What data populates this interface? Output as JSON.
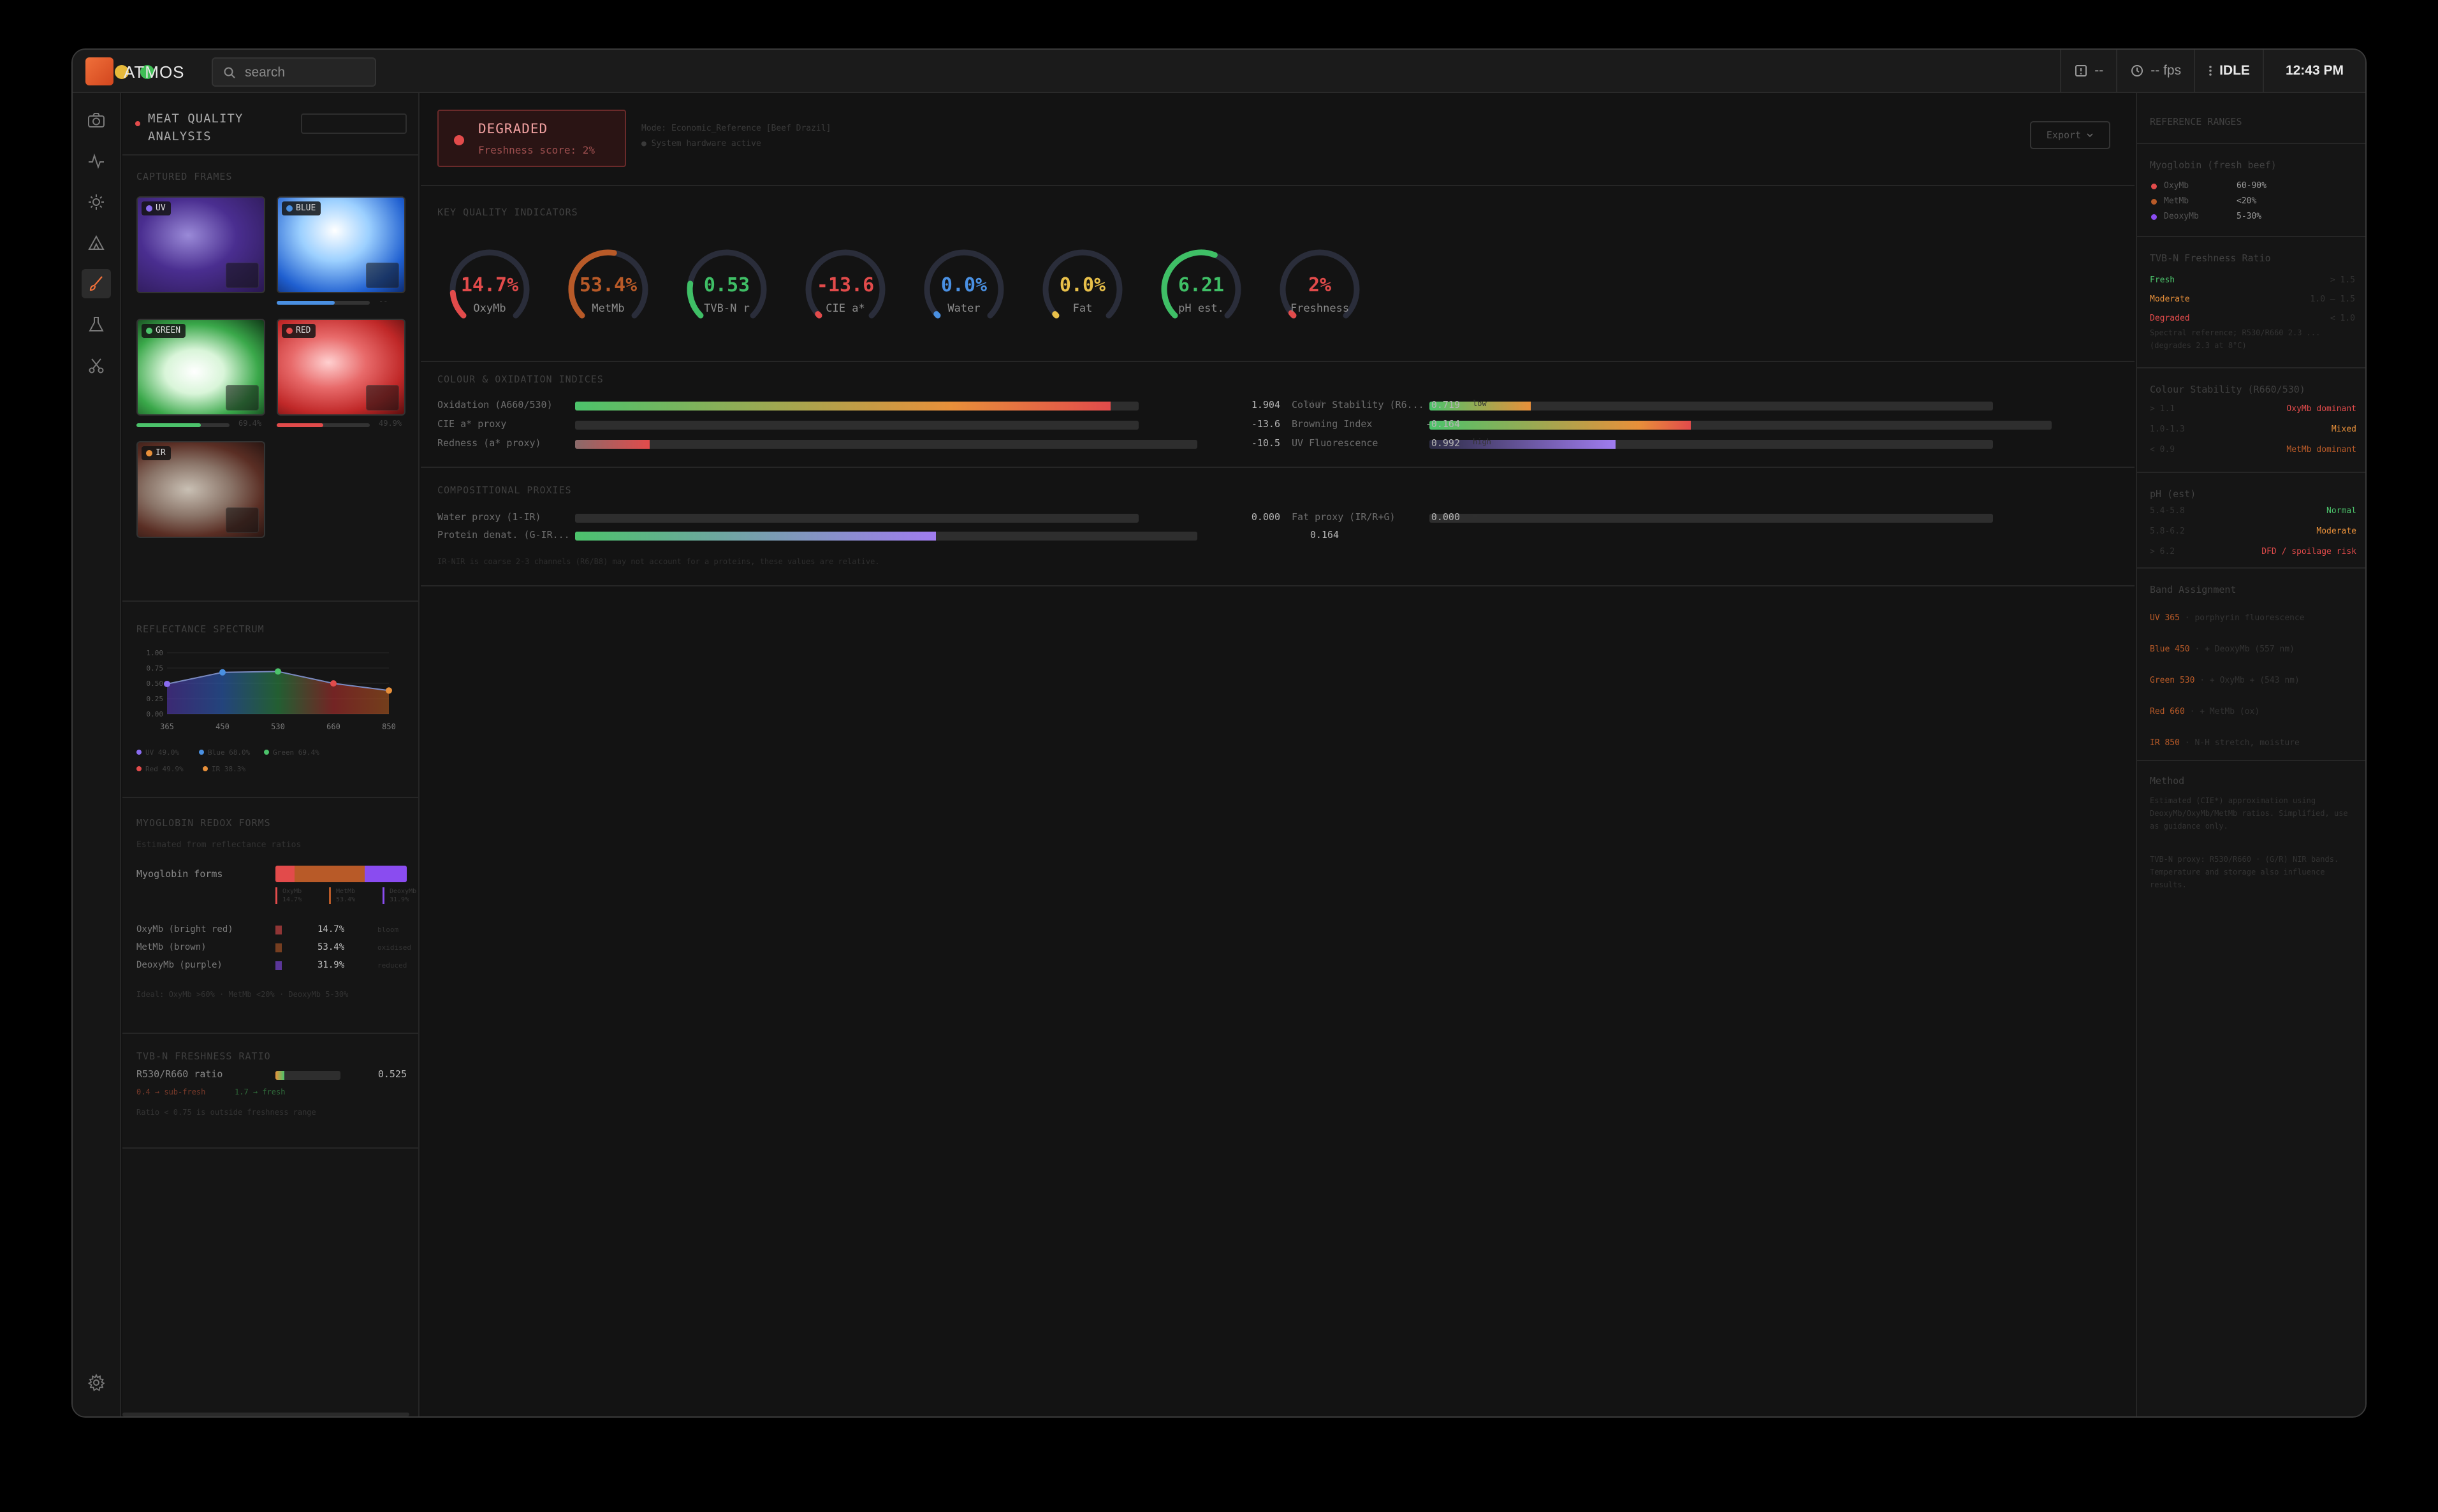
{
  "window": {
    "app_name": "ATMOS",
    "search_placeholder": "search",
    "status_alert": "--",
    "fps": "-- fps",
    "state": "IDLE",
    "clock": "12:43 PM"
  },
  "rail": {
    "icons": [
      "camera-icon",
      "activity-icon",
      "sun-icon",
      "tent-icon",
      "brush-icon",
      "flask-icon",
      "scissors-icon",
      "gear-icon"
    ],
    "active": "brush-icon"
  },
  "left": {
    "title_line1": "MEAT QUALITY",
    "title_line2": "ANALYSIS",
    "frames_title": "CAPTURED FRAMES",
    "frames": [
      {
        "tag": "UV",
        "dot": "#8a6cf0",
        "bar": 0,
        "value": ""
      },
      {
        "tag": "BLUE",
        "dot": "#4a90e2",
        "bar": 0.62,
        "value": "--"
      },
      {
        "tag": "GREEN",
        "dot": "#4cc36b",
        "bar": 0.69,
        "value": "69.4%"
      },
      {
        "tag": "RED",
        "dot": "#e24b4b",
        "bar": 0.5,
        "value": "49.9%"
      },
      {
        "tag": "IR",
        "dot": "#e8903a",
        "bar": 0,
        "value": ""
      }
    ],
    "reflectance_title": "REFLECTANCE SPECTRUM",
    "legend": [
      {
        "label": "UV 49.0%",
        "color": "#8a6cf0"
      },
      {
        "label": "Blue 68.0%",
        "color": "#4a90e2"
      },
      {
        "label": "Green 69.4%",
        "color": "#4cc36b"
      },
      {
        "label": "Red 49.9%",
        "color": "#e24b4b"
      },
      {
        "label": "IR 38.3%",
        "color": "#e8903a"
      }
    ],
    "myoglobin_title": "MYOGLOBIN REDOX FORMS",
    "myoglobin_desc": "Estimated from reflectance ratios",
    "myoglobin_forms_label": "Myoglobin forms",
    "forms": [
      {
        "name": "OxyMb (bright red)",
        "short": "OxyMb",
        "value": "14.7%",
        "fraction": 0.147,
        "color": "#e24b4b",
        "note": "bloom"
      },
      {
        "name": "MetMb (brown)",
        "short": "MetMb",
        "value": "53.4%",
        "fraction": 0.534,
        "color": "#b85a28",
        "note": "oxidised"
      },
      {
        "name": "DeoxyMb (purple)",
        "short": "DeoxyMb",
        "value": "31.9%",
        "fraction": 0.319,
        "color": "#8a4cf0",
        "note": "reduced"
      }
    ],
    "forms_footnote": "Ideal: OxyMb >60% · MetMb <20% · DeoxyMb 5-30%",
    "tvbn_title": "TVB-N FRESHNESS RATIO",
    "tvbn_label": "R530/R660 ratio",
    "tvbn_value": "0.525",
    "tvbn_fraction": 0.14,
    "tvbn_hint_bad": "0.4 → sub-fresh",
    "tvbn_hint_good": "1.7 → fresh",
    "tvbn_footnote": "Ratio < 0.75 is outside freshness range"
  },
  "main": {
    "status": "DEGRADED",
    "freshness": "Freshness score: 2%",
    "meta_line1": "Mode: Economic_Reference [Beef Drazil]",
    "meta_line2": "● System hardware active",
    "export_label": "Export",
    "kpi_title": "KEY QUALITY INDICATORS",
    "gauges": [
      {
        "label": "OxyMb",
        "value": "14.7%",
        "fraction": 0.147,
        "color": "#e24b4b",
        "track": "#2a2d3a"
      },
      {
        "label": "MetMb",
        "value": "53.4%",
        "fraction": 0.534,
        "color": "#b85a28",
        "track": "#2a2d3a"
      },
      {
        "label": "TVB-N r",
        "value": "0.53",
        "fraction": 0.2,
        "color": "#3fbf66",
        "track": "#2a2d3a"
      },
      {
        "label": "CIE a*",
        "value": "-13.6",
        "fraction": 0,
        "color": "#e24b4b",
        "track": "#2a2d3a"
      },
      {
        "label": "Water",
        "value": "0.0%",
        "fraction": 0,
        "color": "#4a90e2",
        "track": "#2a2d3a"
      },
      {
        "label": "Fat",
        "value": "0.0%",
        "fraction": 0,
        "color": "#e8c04a",
        "track": "#2a2d3a"
      },
      {
        "label": "pH est.",
        "value": "6.21",
        "fraction": 0.58,
        "color": "#3fbf66",
        "track": "#2a2d3a"
      },
      {
        "label": "Freshness",
        "value": "2%",
        "fraction": 0.02,
        "color": "#e24b4b",
        "track": "#2a2d3a"
      }
    ],
    "colour_title": "COLOUR & OXIDATION INDICES",
    "colour_left": [
      {
        "label": "Oxidation (A660/530)",
        "value": "1.904",
        "fraction": 0.95,
        "fill": "linear-gradient(90deg,#4cc36b,#e8903a 70%,#e24b4b)",
        "note": "high"
      },
      {
        "label": "CIE a* proxy",
        "value": "-13.6",
        "fraction": 0,
        "fill": "#e24b4b",
        "note": "—"
      },
      {
        "label": "Redness (a* proxy)",
        "value": "-10.5",
        "fraction": 0.12,
        "fill": "linear-gradient(90deg,#8a6a6a,#e24b4b)",
        "note": ""
      }
    ],
    "colour_right": [
      {
        "label": "Colour Stability (R6...",
        "value": "0.719",
        "fraction": 0.18,
        "fill": "linear-gradient(90deg,#4cc36b,#e8903a)",
        "note": "low"
      },
      {
        "label": "Browning Index",
        "value": "-0.164",
        "fraction": 0.42,
        "fill": "linear-gradient(90deg,#4cc36b,#e8903a 80%,#e24b4b)",
        "note": ""
      },
      {
        "label": "UV Fluorescence",
        "value": "0.992",
        "fraction": 0.33,
        "fill": "linear-gradient(90deg,#2c2c44,#a07cf0)",
        "note": "high"
      }
    ],
    "comp_title": "COMPOSITIONAL PROXIES",
    "comp_rows": [
      {
        "label": "Water proxy (1-IR)",
        "value": "0.000",
        "fraction": 0,
        "fill": "#4a90e2",
        "note": ""
      },
      {
        "label": "Fat proxy (IR/R+G)",
        "value": "0.000",
        "fraction": 0,
        "fill": "#e8c04a",
        "note": "—"
      },
      {
        "label": "Protein denat. (G-IR...",
        "value": "0.164",
        "fraction": 0.58,
        "fill": "linear-gradient(90deg,#4cc36b,#a07cf0)",
        "note": ""
      }
    ],
    "comp_footnote": "IR-NIR is coarse 2-3 channels (R6/B8) may not account for a proteins, these values are relative."
  },
  "right": {
    "title": "REFERENCE RANGES",
    "myo_title": "Myoglobin (fresh beef)",
    "myo": [
      {
        "name": "OxyMb",
        "range": "60-90%",
        "color": "#e24b4b"
      },
      {
        "name": "MetMb",
        "range": "<20%",
        "color": "#b85a28"
      },
      {
        "name": "DeoxyMb",
        "range": "5-30%",
        "color": "#8a4cf0"
      }
    ],
    "tvbn_title": "TVB-N Freshness Ratio",
    "tvbn": [
      {
        "name": "Fresh",
        "range": "> 1.5",
        "color": "#4cc36b"
      },
      {
        "name": "Moderate",
        "range": "1.0 – 1.5",
        "color": "#e8903a"
      },
      {
        "name": "Degraded",
        "range": "< 1.0",
        "color": "#e24b4b"
      }
    ],
    "tvbn_note": "Spectral reference; R530/R660 2.3 ... (degrades 2.3 at 8°C)",
    "stab_title": "Colour Stability (R660/530)",
    "stab": [
      {
        "range": "> 1.1",
        "desc": "OxyMb dominant",
        "color": "#e24b4b"
      },
      {
        "range": "1.0-1.3",
        "desc": "Mixed",
        "color": "#e8903a"
      },
      {
        "range": "< 0.9",
        "desc": "MetMb dominant",
        "color": "#b85a28"
      }
    ],
    "ph_title": "pH (est)",
    "ph": [
      {
        "range": "5.4-5.8",
        "desc": "Normal",
        "color": "#4cc36b"
      },
      {
        "range": "5.8-6.2",
        "desc": "Moderate",
        "color": "#e8903a"
      },
      {
        "range": "> 6.2",
        "desc": "DFD / spoilage risk",
        "color": "#e24b4b"
      }
    ],
    "band_title": "Band Assignment",
    "bands": [
      {
        "name": "UV 365",
        "desc": "· porphyrin fluorescence",
        "color": "#b85a28"
      },
      {
        "name": "Blue 450",
        "desc": "· + DeoxyMb (557 nm)",
        "color": "#b85a28"
      },
      {
        "name": "Green 530",
        "desc": "· + OxyMb + (543 nm)",
        "color": "#b85a28"
      },
      {
        "name": "Red 660",
        "desc": "· + MetMb (ox)",
        "color": "#b85a28"
      },
      {
        "name": "IR 850",
        "desc": "· N-H stretch, moisture",
        "color": "#b85a28"
      }
    ],
    "method_title": "Method",
    "method_p1": "Estimated (CIE*) approximation using DeoxyMb/OxyMb/MetMb ratios. Simplified, use as guidance only.",
    "method_p2": "TVB-N proxy: R530/R660 · (G/R) NIR bands. Temperature and storage also influence results."
  }
}
